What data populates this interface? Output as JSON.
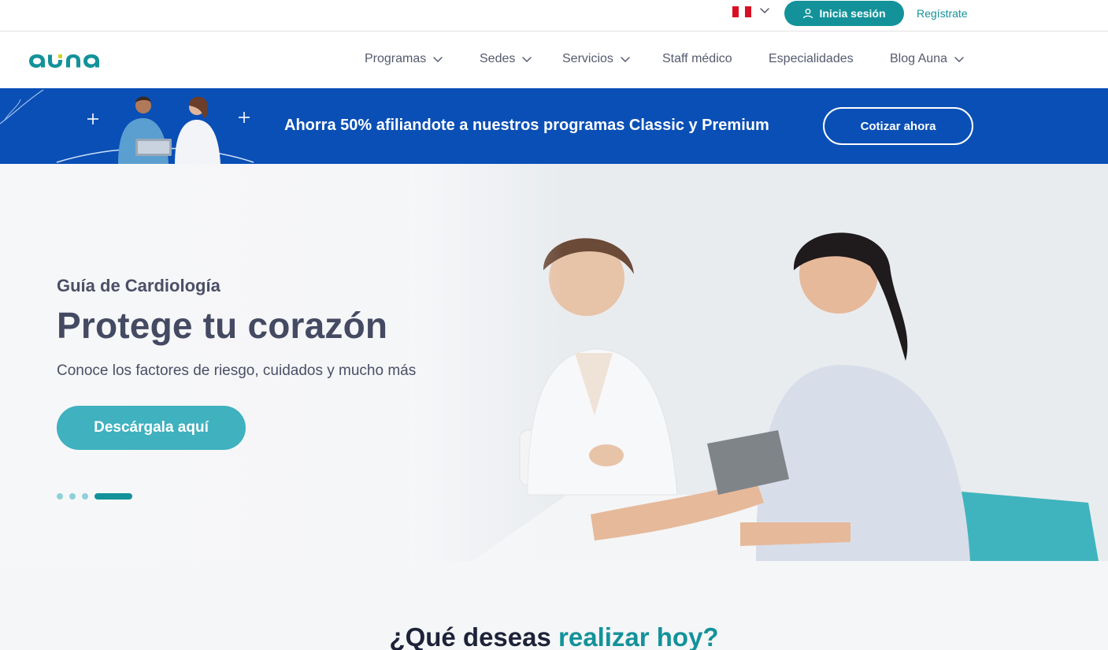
{
  "topbar": {
    "country": "Perú",
    "login_label": "Inicia sesión",
    "register_label": "Regístrate"
  },
  "brand": {
    "logo_text": "auna",
    "accent": "#13929a",
    "logo_dot": "#c6d62a"
  },
  "nav": {
    "items": [
      {
        "label": "Programas",
        "dropdown": true
      },
      {
        "label": "Sedes",
        "dropdown": true
      },
      {
        "label": "Servicios",
        "dropdown": true
      },
      {
        "label": "Staff médico",
        "dropdown": false
      },
      {
        "label": "Especialidades",
        "dropdown": false
      },
      {
        "label": "Blog Auna",
        "dropdown": true
      }
    ]
  },
  "promo": {
    "text": "Ahorra 50% afiliandote a nuestros programas Classic y Premium",
    "button_label": "Cotizar ahora",
    "background": "#0a4fb6"
  },
  "hero": {
    "subtitle": "Guía de Cardiología",
    "title": "Protege tu corazón",
    "description": "Conoce los factores de riesgo, cuidados y mucho más",
    "button_label": "Descárgala aquí",
    "button_color": "#3fb1bf",
    "slides_total": 4,
    "active_slide": 4
  },
  "section": {
    "question_prefix": "¿Qué deseas",
    "question_highlight": "realizar hoy?"
  }
}
